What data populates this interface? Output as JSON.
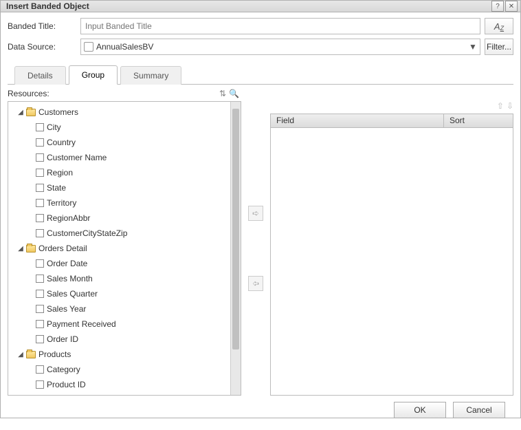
{
  "title": "Insert Banded Object",
  "form": {
    "banded_title_label": "Banded Title:",
    "banded_title_placeholder": "Input Banded Title",
    "data_source_label": "Data Source:",
    "data_source_value": "AnnualSalesBV",
    "filter_label": "Filter..."
  },
  "tabs": {
    "details": "Details",
    "group": "Group",
    "summary": "Summary"
  },
  "resources_label": "Resources:",
  "grid": {
    "field": "Field",
    "sort": "Sort"
  },
  "tree": [
    {
      "type": "folder",
      "label": "Customers",
      "children": [
        {
          "label": "City"
        },
        {
          "label": "Country"
        },
        {
          "label": "Customer Name"
        },
        {
          "label": "Region"
        },
        {
          "label": "State"
        },
        {
          "label": "Territory"
        },
        {
          "label": "RegionAbbr"
        },
        {
          "label": "CustomerCityStateZip"
        }
      ]
    },
    {
      "type": "folder",
      "label": "Orders Detail",
      "children": [
        {
          "label": "Order Date"
        },
        {
          "label": "Sales Month"
        },
        {
          "label": "Sales Quarter"
        },
        {
          "label": "Sales Year"
        },
        {
          "label": "Payment Received"
        },
        {
          "label": "Order ID"
        }
      ]
    },
    {
      "type": "folder",
      "label": "Products",
      "children": [
        {
          "label": "Category"
        },
        {
          "label": "Product ID"
        }
      ]
    }
  ],
  "buttons": {
    "ok": "OK",
    "cancel": "Cancel"
  },
  "font_btn": "A",
  "font_btn_sub": "Z"
}
